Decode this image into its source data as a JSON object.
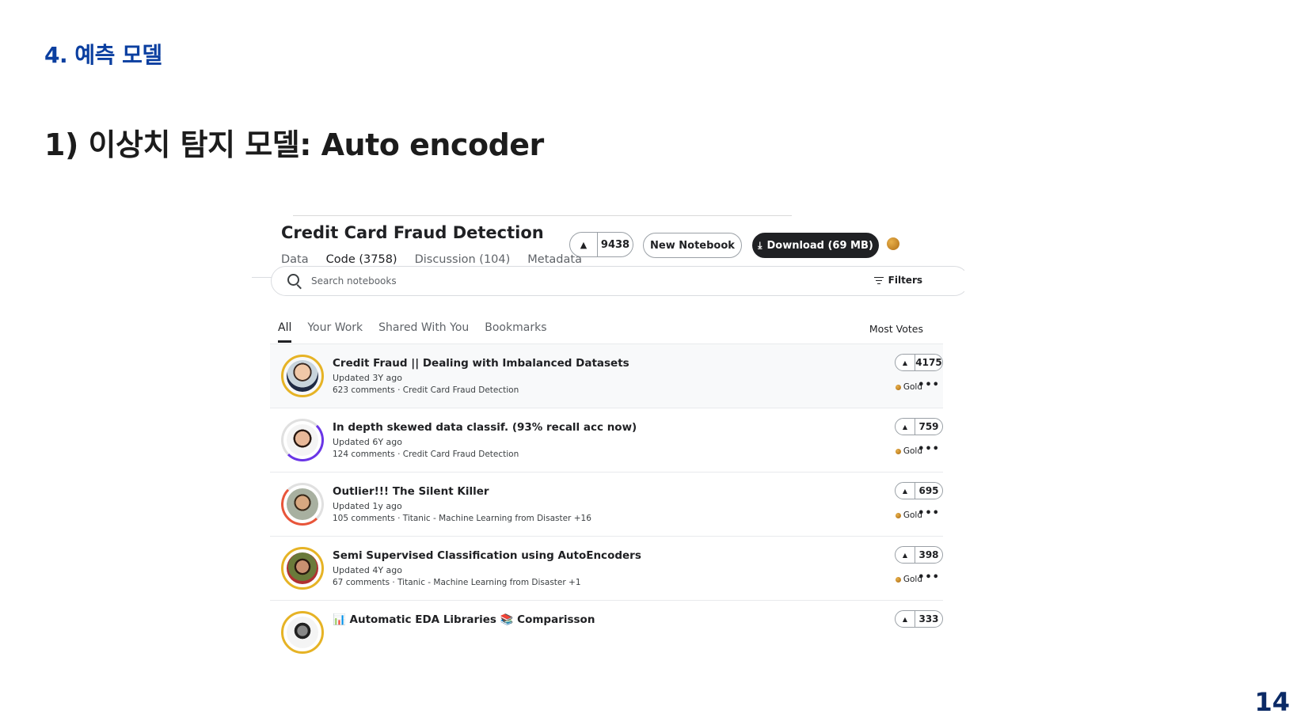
{
  "slide": {
    "section_title": "4. 예측 모델",
    "heading": "1) 이상치 탐지 모델: Auto encoder",
    "page_number": "14"
  },
  "dataset": {
    "title": "Credit Card Fraud Detection",
    "tabs": [
      {
        "label": "Data"
      },
      {
        "label": "Code (3758)",
        "active": true
      },
      {
        "label": "Discussion (104)"
      },
      {
        "label": "Metadata"
      }
    ],
    "upvotes": "9438",
    "new_notebook_label": "New Notebook",
    "download_label": "Download (69 MB)"
  },
  "search": {
    "placeholder": "Search notebooks",
    "filters_label": "Filters"
  },
  "subtabs": [
    {
      "label": "All",
      "active": true
    },
    {
      "label": "Your Work"
    },
    {
      "label": "Shared With You"
    },
    {
      "label": "Bookmarks"
    }
  ],
  "sort_label": "Most Votes",
  "notebooks": [
    {
      "title": "Credit Fraud || Dealing with Imbalanced Datasets",
      "updated": "Updated 3Y ago",
      "meta": "623 comments · Credit Card Fraud Detection",
      "votes": "4175",
      "medal": "Gold",
      "ring_color": "#e6b325"
    },
    {
      "title": "In depth skewed data classif. (93% recall acc now)",
      "updated": "Updated 6Y ago",
      "meta": "124 comments · Credit Card Fraud Detection",
      "votes": "759",
      "medal": "Gold",
      "ring_color": "#6a35e6"
    },
    {
      "title": "Outlier!!! The Silent Killer",
      "updated": "Updated 1y ago",
      "meta": "105 comments · Titanic - Machine Learning from Disaster +16",
      "votes": "695",
      "medal": "Gold",
      "ring_color": "#e8553a"
    },
    {
      "title": "Semi Supervised Classification using AutoEncoders",
      "updated": "Updated 4Y ago",
      "meta": "67 comments · Titanic - Machine Learning from Disaster +1",
      "votes": "398",
      "medal": "Gold",
      "ring_color": "#e6b325"
    },
    {
      "title": "📊 Automatic EDA Libraries 📚 Comparisson",
      "updated": "",
      "meta": "",
      "votes": "333",
      "medal": "",
      "ring_color": "#e6b325"
    }
  ]
}
